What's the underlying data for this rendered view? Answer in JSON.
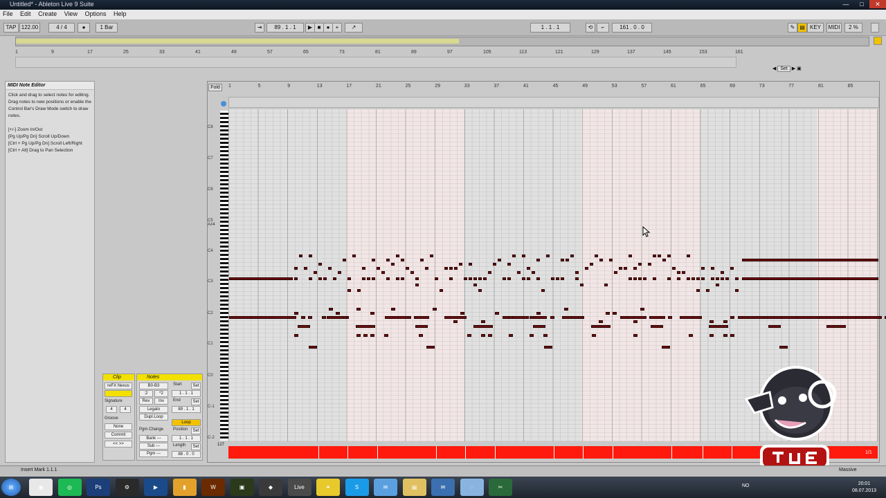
{
  "window": {
    "title": "Untitled* - Ableton Live 9 Suite",
    "min": "—",
    "max": "□",
    "close": "✕"
  },
  "menu": [
    "File",
    "Edit",
    "Create",
    "View",
    "Options",
    "Help"
  ],
  "control_bar": {
    "tap": "TAP",
    "tempo": "122.00",
    "signature": "4 / 4",
    "quantize": "1 Bar",
    "arrangement_position": "89 . 1 . 1",
    "loop_start": "1 . 1 . 1",
    "loop_length": "161 . 0 . 0",
    "key": "KEY",
    "midi": "MIDI",
    "cpu": "2 %"
  },
  "overview_ruler": [
    "1",
    "9",
    "17",
    "25",
    "33",
    "41",
    "49",
    "57",
    "65",
    "73",
    "81",
    "89",
    "97",
    "105",
    "113",
    "121",
    "129",
    "137",
    "145",
    "153",
    "161"
  ],
  "set_label": "Set",
  "info_view": {
    "title": "MIDI Note Editor",
    "text": "Click and drag to select notes for editing. Drag notes to new positions or enable the Control Bar's Draw Mode switch to draw notes.",
    "shortcuts": [
      "[+/-] Zoom In/Out",
      "[Pg Up/Pg Dn] Scroll Up/Down",
      "[Ctrl + Pg Up/Pg Dn] Scroll Left/Right",
      "[Ctrl + Alt] Drag to Pan Selection"
    ]
  },
  "clip_box": {
    "title": "Clip",
    "name": "reFX Nexus",
    "signature_label": "Signature",
    "sig_num": "4",
    "sig_den": "4",
    "groove_label": "Groove",
    "groove_value": "None",
    "commit": "Commit"
  },
  "notes_box": {
    "title": "Notes",
    "range": "B0-B3",
    "div2": ":2",
    "mul2": "*2",
    "rev": "Rev",
    "inv": "Inv",
    "legato": "Legato",
    "dupl_loop": "Dupl.Loop",
    "pgm_change": "Pgm Change",
    "bank": "Bank ---",
    "sub": "Sub ---",
    "pgm": "Pgm ---",
    "start_label": "Start",
    "start": "1 . 1 . 1",
    "end_label": "End",
    "end": "89 . 1 . 1",
    "loop": "Loop",
    "position_label": "Position",
    "position": "1 . 1 . 1",
    "length_label": "Length",
    "length": "88 . 0 . 0",
    "set": "Set"
  },
  "piano_roll": {
    "fold": "Fold",
    "ruler": [
      "1",
      "5",
      "9",
      "13",
      "17",
      "21",
      "25",
      "29",
      "33",
      "37",
      "41",
      "45",
      "49",
      "53",
      "57",
      "61",
      "65",
      "69",
      "73",
      "77",
      "81",
      "85"
    ],
    "octaves": [
      "C8",
      "C7",
      "C6",
      "C5",
      "A#4",
      "C4",
      "C3",
      "C2",
      "C1",
      "C0",
      "C-1",
      "C-2"
    ],
    "velocity_max": "127",
    "page": "1/1"
  },
  "status": {
    "text": "Insert Mark 1.1.1",
    "device": "Massive"
  },
  "taskbar": {
    "apps": [
      "Chrome",
      "Spotify",
      "Ps",
      "Steam",
      "Media",
      "Word",
      "WoW",
      "Winamp",
      "Ableton",
      "Live",
      "Norton",
      "Skype",
      "Mail",
      "Explorer",
      "Outlook",
      "Calc",
      "Snip"
    ],
    "lang": "NO",
    "time": "20:01",
    "date": "08.07.2013"
  },
  "colors": {
    "accent": "#f2e100",
    "velocity": "#ff1a0d",
    "note": "#6b0f0f"
  }
}
